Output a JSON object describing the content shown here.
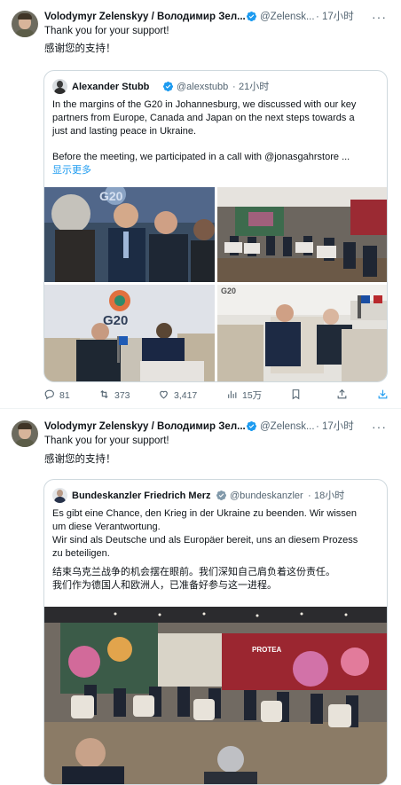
{
  "tweets": [
    {
      "author": "Volodymyr Zelenskyy / Володимир Зел...",
      "handle": "@Zelensk...",
      "time": "17小时",
      "more": "···",
      "text_en": "Thank you for your support!",
      "text_zh": "感谢您的支持！",
      "quote": {
        "author": "Alexander Stubb",
        "handle": "@alexstubb",
        "time": "21小时",
        "lines": [
          "In the margins of the G20 in Johannesburg, we discussed with our key",
          "partners from Europe, Canada and Japan on the next steps towards a",
          "just and lasting peace in Ukraine.",
          "Before the meeting, we participated in a call with @jonasgahrstore  ..."
        ],
        "show_more": "显示更多",
        "photos": [
          "g20-backdrop",
          "meeting-room",
          "g20-podium",
          "bilateral-chairs"
        ],
        "logo_text": "G20"
      },
      "actions": {
        "replies": "81",
        "reposts": "373",
        "likes": "3,417",
        "views": "15万"
      }
    },
    {
      "author": "Volodymyr Zelenskyy / Володимир Зел...",
      "handle": "@Zelensk...",
      "time": "17小时",
      "more": "···",
      "text_en": "Thank you for your support!",
      "text_zh": "感谢您的支持！",
      "quote": {
        "author": "Bundeskanzler Friedrich Merz",
        "handle": "@bundeskanzler",
        "time": "18小时",
        "lines": [
          "Es gibt eine Chance, den Krieg in der Ukraine zu beenden. Wir wissen",
          "um diese Verantwortung.",
          "Wir sind als Deutsche und als Europäer bereit, uns an diesem Prozess",
          "zu beteiligen.",
          "结束乌克兰战争的机会摆在眼前。我们深知自己肩负着这份责任。",
          "我们作为德国人和欧洲人，已准备好参与这一进程。"
        ],
        "photos": [
          "summit-circle"
        ],
        "banner_text": "PROTEA"
      }
    }
  ],
  "colors": {
    "verified": "#1d9bf0",
    "muted": "#536471",
    "border": "#cfd9de",
    "link": "#1d9bf0"
  },
  "icons": [
    "verified-badge-icon",
    "reply-icon",
    "repost-icon",
    "like-icon",
    "views-icon",
    "bookmark-icon",
    "share-icon",
    "download-icon",
    "more-icon"
  ]
}
